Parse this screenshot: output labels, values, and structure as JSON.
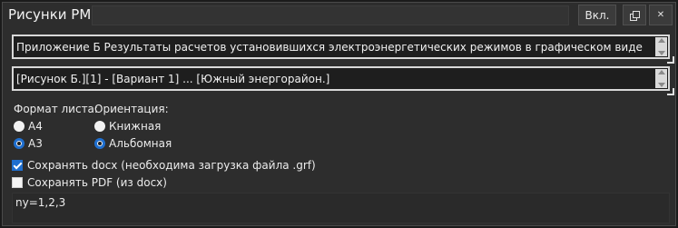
{
  "window": {
    "title": "Рисунки РМ",
    "on_button_label": "Вкл.",
    "copy_icon": "copy-icon",
    "close_icon": "close-icon",
    "close_glyph": "✕"
  },
  "fields": {
    "caption_value": "Приложение Б Результаты расчетов установившихся электроэнергетических режимов в графическом виде",
    "figure_value": "[Рисунок Б.][1] - [Вариант 1] ... [Южный энергорайон.]"
  },
  "sheet_format": {
    "label": "Формат листа:",
    "options": [
      "А4",
      "А3"
    ],
    "selected": "А3"
  },
  "orientation": {
    "label": "Ориентация:",
    "options": [
      "Книжная",
      "Альбомная"
    ],
    "selected": "Альбомная"
  },
  "options": {
    "save_docx_label": "Сохранять docx (необходима загрузка файла .grf)",
    "save_docx_checked": true,
    "save_pdf_label": "Сохранять PDF (из docx)",
    "save_pdf_checked": false
  },
  "ny_text": "ny=1,2,3",
  "colors": {
    "background": "#2d2d2d",
    "accent": "#1f6fcf",
    "field_border": "#d8d8d8"
  }
}
